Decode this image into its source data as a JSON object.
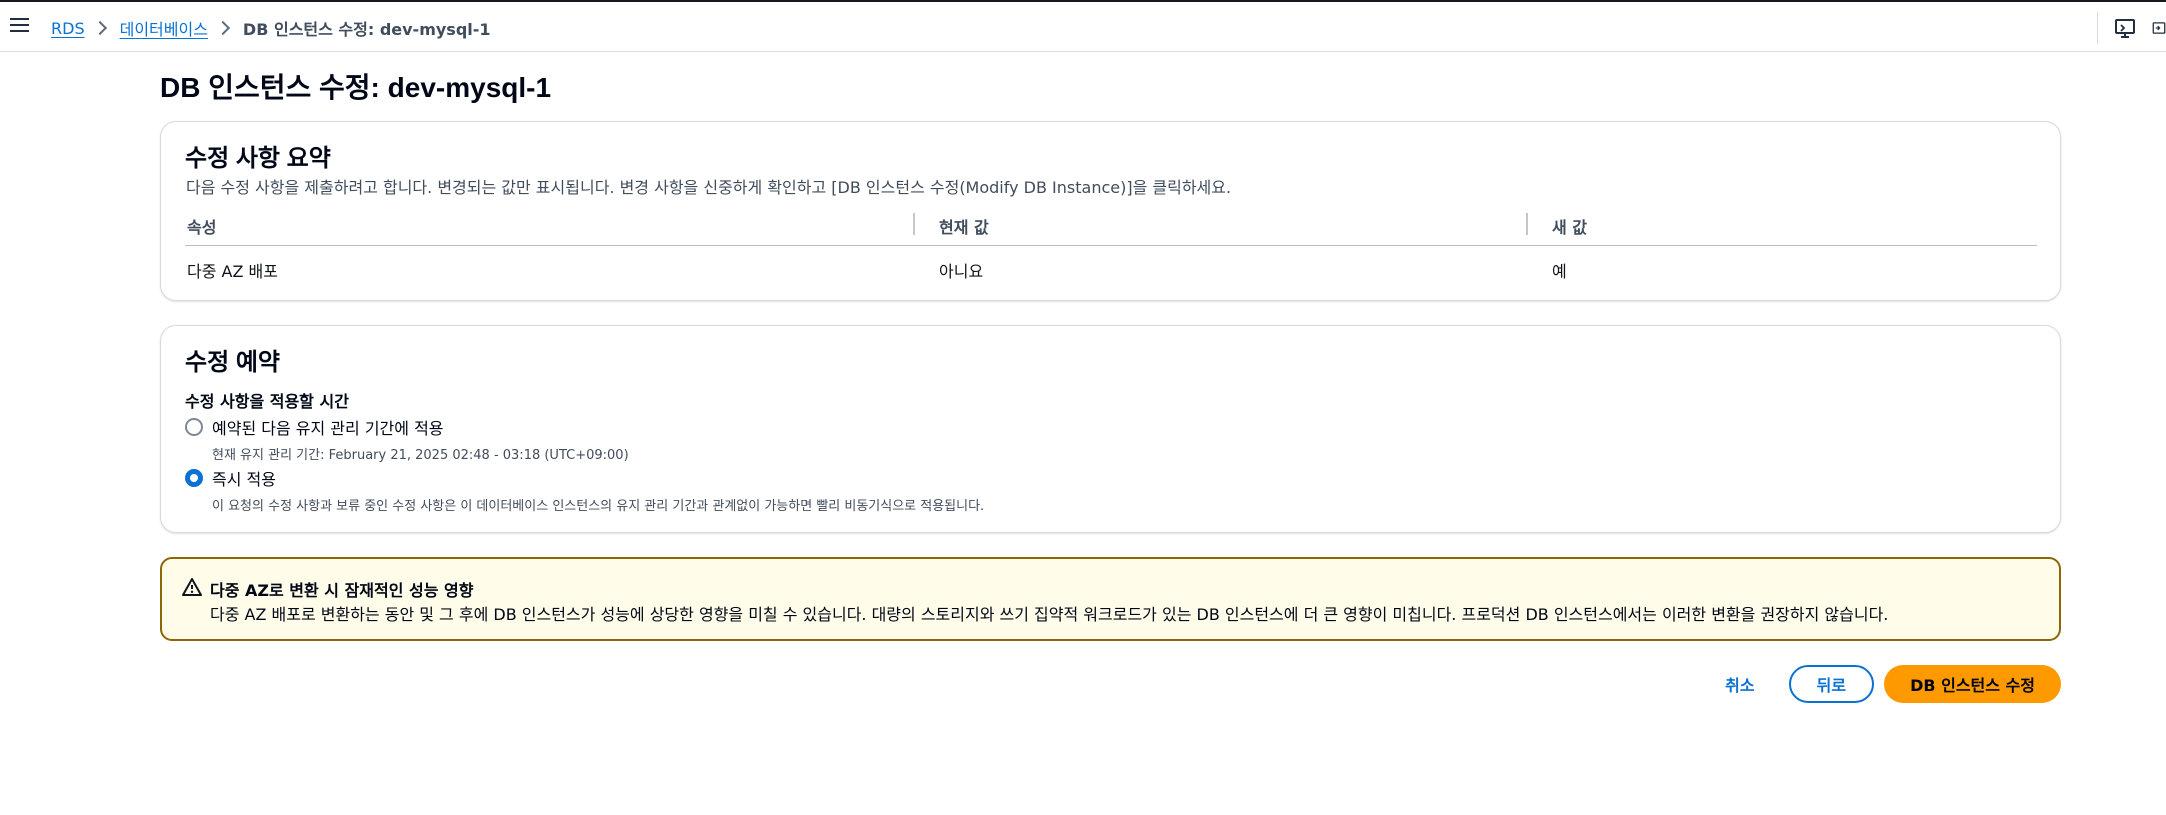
{
  "breadcrumb": {
    "items": [
      "RDS",
      "데이터베이스"
    ],
    "current": "DB 인스턴스 수정: dev-mysql-1"
  },
  "page": {
    "title": "DB 인스턴스 수정: dev-mysql-1"
  },
  "summary": {
    "title": "수정 사항 요약",
    "description": "다음 수정 사항을 제출하려고 합니다. 변경되는 값만 표시됩니다. 변경 사항을 신중하게 확인하고 [DB 인스턴스 수정(Modify DB Instance)]을 클릭하세요.",
    "columns": [
      "속성",
      "현재 값",
      "새 값"
    ],
    "rows": [
      [
        "다중 AZ 배포",
        "아니요",
        "예"
      ]
    ]
  },
  "schedule": {
    "title": "수정 예약",
    "field_label": "수정 사항을 적용할 시간",
    "options": [
      {
        "label": "예약된 다음 유지 관리 기간에 적용",
        "description": "현재 유지 관리 기간: February 21, 2025 02:48 - 03:18 (UTC+09:00)",
        "selected": false
      },
      {
        "label": "즉시 적용",
        "description": "이 요청의 수정 사항과 보류 중인 수정 사항은 이 데이터베이스 인스턴스의 유지 관리 기간과 관계없이 가능하면 빨리 비동기식으로 적용됩니다.",
        "selected": true
      }
    ]
  },
  "alert": {
    "icon": "warning-icon",
    "title": "다중 AZ로 변환 시 잠재적인 성능 영향",
    "body": "다중 AZ 배포로 변환하는 동안 및 그 후에 DB 인스턴스가 성능에 상당한 영향을 미칠 수 있습니다. 대량의 스토리지와 쓰기 집약적 워크로드가 있는 DB 인스턴스에 더 큰 영향이 미칩니다. 프로덕션 DB 인스턴스에서는 이러한 변환을 권장하지 않습니다."
  },
  "actions": {
    "cancel": "취소",
    "back": "뒤로",
    "submit": "DB 인스턴스 수정"
  },
  "colors": {
    "link": "#0972d3",
    "primary_button": "#ff9900",
    "alert_border": "#8d6605",
    "alert_bg": "#fffce9"
  }
}
